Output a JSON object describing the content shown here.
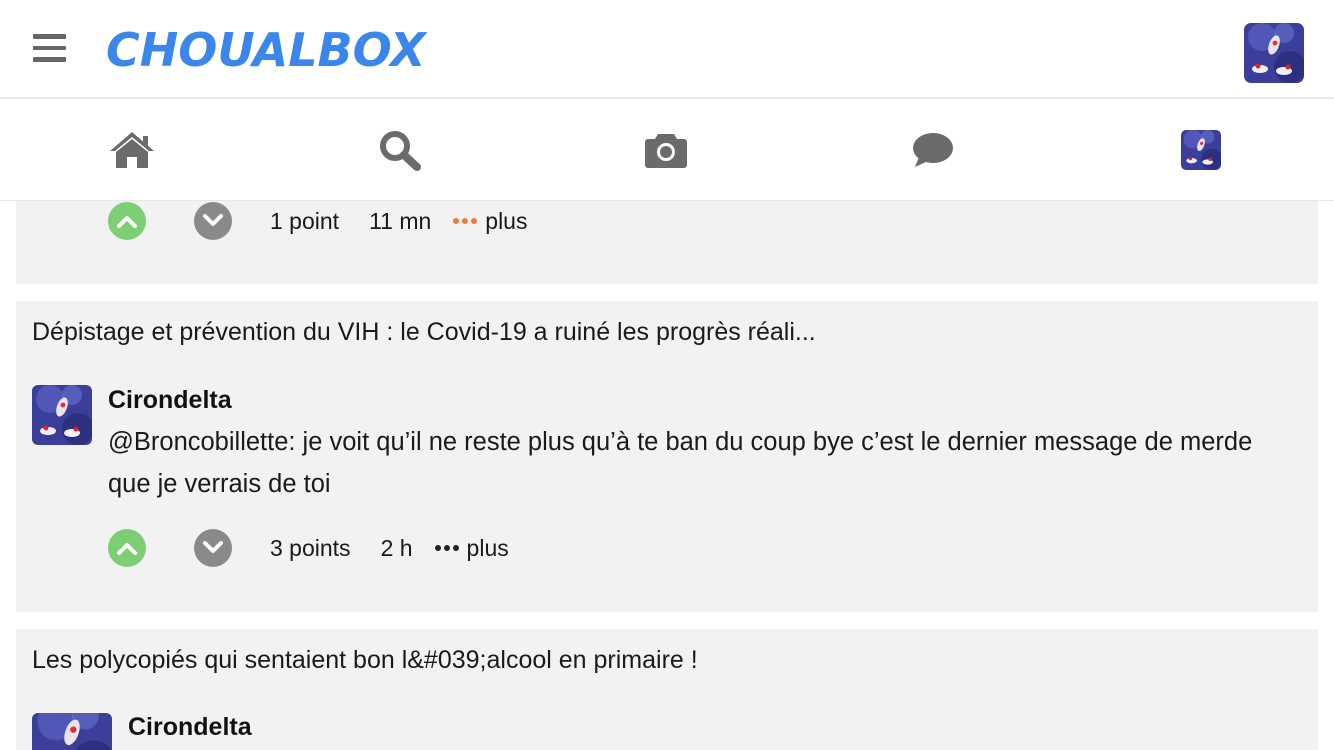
{
  "app": {
    "logo_text": "CHOUALBOX",
    "brand_color": "#3a86ea"
  },
  "nav": {
    "icons": [
      "home-icon",
      "search-icon",
      "camera-icon",
      "chat-icon",
      "profile-avatar"
    ]
  },
  "feed": [
    {
      "points": "1 point",
      "time": "11 mn",
      "more_label": "plus",
      "more_dots_color": "#f07a3a"
    },
    {
      "title": "Dépistage et prévention du VIH : le Covid-19 a ruiné les progrès réali...",
      "author": "Cirondelta",
      "comment": "@Broncobillette: je voit qu’il ne reste plus qu’à te ban du coup bye c’est le dernier message de merde que je verrais de toi",
      "points": "3 points",
      "time": "2 h",
      "more_label": "plus",
      "more_dots_color": "#222222"
    },
    {
      "title": "Les polycopiés qui sentaient bon l&#039;alcool en primaire !",
      "author": "Cirondelta"
    }
  ],
  "colors": {
    "upvote": "#7dce74",
    "downvote": "#8a8a8a",
    "card_bg": "#f2f2f2",
    "icon_gray": "#6b6b6b"
  }
}
